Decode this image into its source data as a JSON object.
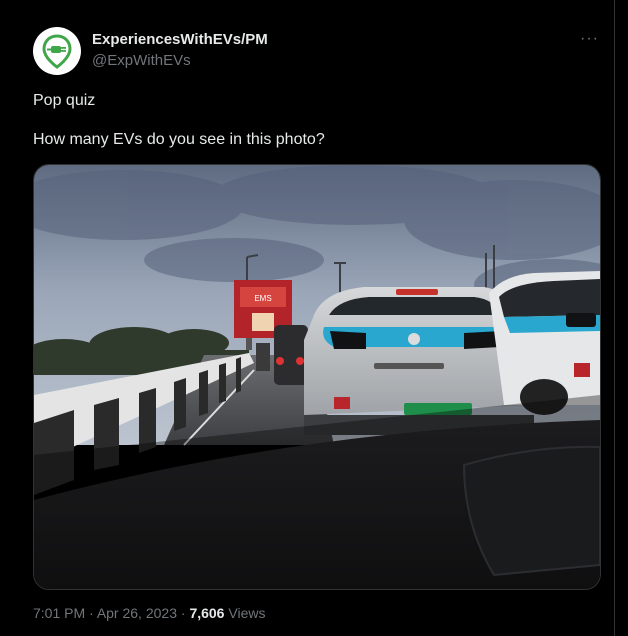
{
  "author": {
    "display_name": "ExperiencesWithEVs/PM",
    "handle": "@ExpWithEVs",
    "avatar_icon": "ev-charging-plug-icon",
    "brand_color": "#3fa64a"
  },
  "tweet": {
    "line1": "Pop quiz",
    "line2": "How many EVs do you see in this photo?"
  },
  "more_icon": "···",
  "photo": {
    "billboard_text": "EMS"
  },
  "meta": {
    "time": "7:01 PM",
    "sep1": " · ",
    "date": "Apr 26, 2023",
    "sep2": " · ",
    "views_count": "7,606",
    "views_label": " Views"
  }
}
